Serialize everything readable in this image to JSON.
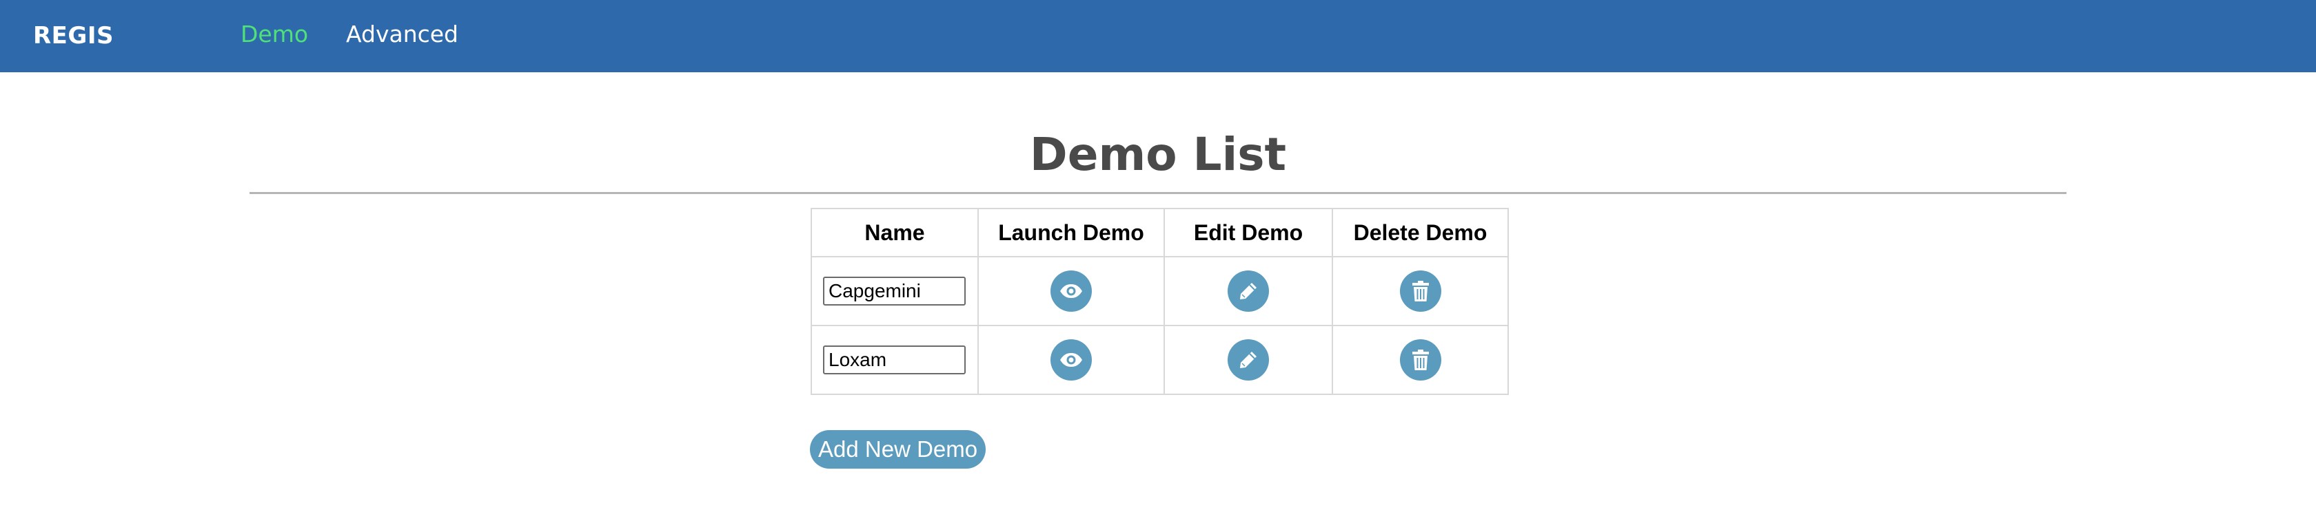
{
  "navbar": {
    "brand": "REGIS",
    "links": [
      {
        "label": "Demo",
        "active": true,
        "color": "#4fe07a"
      },
      {
        "label": "Advanced",
        "active": false,
        "color": "#ffffff"
      }
    ],
    "background": "#2d69ab"
  },
  "page": {
    "title": "Demo List"
  },
  "table": {
    "headers": [
      "Name",
      "Launch Demo",
      "Edit Demo",
      "Delete Demo"
    ],
    "rows": [
      {
        "name": "Capgemini",
        "launch_icon": "eye-icon",
        "edit_icon": "pencil-icon",
        "delete_icon": "trash-icon"
      },
      {
        "name": "Loxam",
        "launch_icon": "eye-icon",
        "edit_icon": "pencil-icon",
        "delete_icon": "trash-icon"
      }
    ]
  },
  "actions": {
    "add_label": "Add New Demo"
  },
  "colors": {
    "accent": "#5b9bbd",
    "title_text": "#4a4a4a"
  }
}
